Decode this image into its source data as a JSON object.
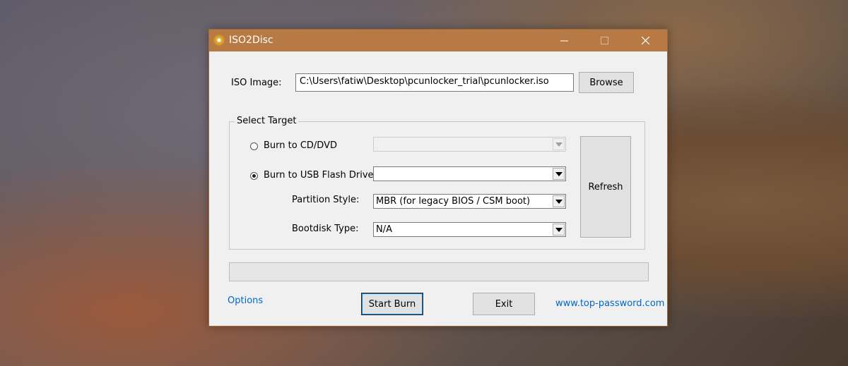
{
  "window": {
    "title": "ISO2Disc",
    "controls": {
      "minimize": "minimize-icon",
      "maximize": "maximize-icon",
      "close": "close-icon"
    }
  },
  "iso": {
    "label": "ISO Image:",
    "path": "C:\\Users\\fatiw\\Desktop\\pcunlocker_trial\\pcunlocker.iso",
    "browse_label": "Browse"
  },
  "target": {
    "group_label": "Select Target",
    "cd_label": "Burn to CD/DVD",
    "cd_selected": false,
    "cd_drive_value": "",
    "usb_label": "Burn to USB Flash Drive",
    "usb_selected": true,
    "usb_drive_value": "",
    "partition_label": "Partition Style:",
    "partition_value": "MBR (for legacy BIOS / CSM boot)",
    "bootdisk_label": "Bootdisk Type:",
    "bootdisk_value": "N/A",
    "refresh_label": "Refresh"
  },
  "progress": {
    "value": 0
  },
  "footer": {
    "options_label": "Options",
    "start_label": "Start Burn",
    "exit_label": "Exit",
    "site_label": "www.top-password.com"
  },
  "colors": {
    "titlebar": "#b87a45",
    "link": "#0066cc"
  }
}
